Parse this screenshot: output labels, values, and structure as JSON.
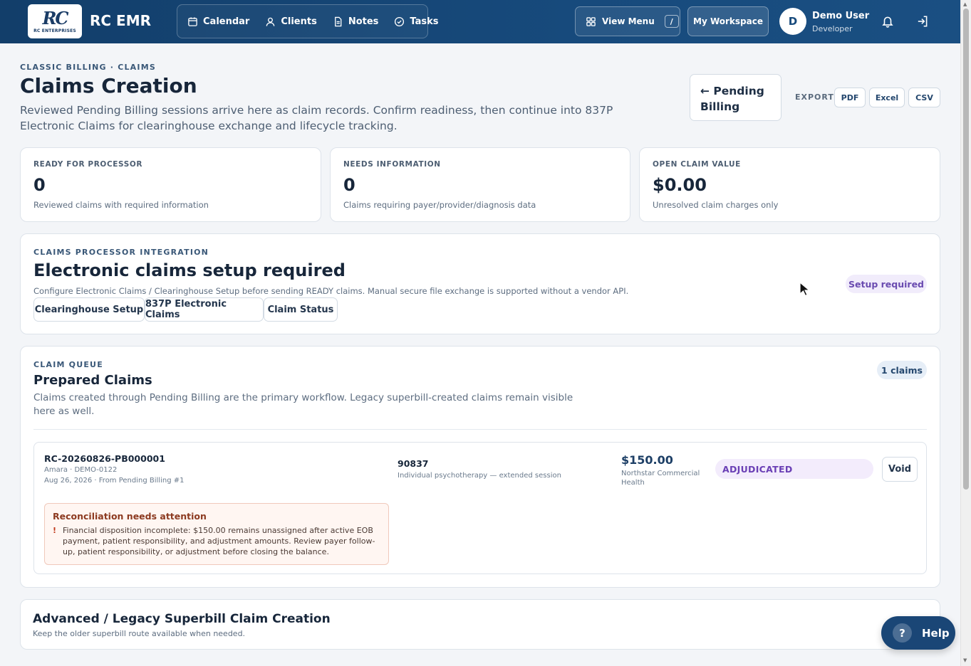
{
  "topbar": {
    "logo_mark": "RC",
    "logo_sub": "RC ENTERPRISES",
    "brand": "RC EMR",
    "nav": [
      {
        "label": "Calendar",
        "icon": "calendar-icon"
      },
      {
        "label": "Clients",
        "icon": "user-icon"
      },
      {
        "label": "Notes",
        "icon": "document-icon"
      },
      {
        "label": "Tasks",
        "icon": "check-circle-icon"
      }
    ],
    "view_menu": "View Menu",
    "view_menu_shortcut": "/",
    "workspace": "My Workspace",
    "avatar_initial": "D",
    "user_name": "Demo User",
    "user_role": "Developer"
  },
  "header": {
    "eyebrow": "CLASSIC BILLING · CLAIMS",
    "title": "Claims Creation",
    "description": "Reviewed Pending Billing sessions arrive here as claim records. Confirm readiness, then continue into 837P Electronic Claims for clearinghouse exchange and lifecycle tracking.",
    "pending_button": "← Pending Billing",
    "export_label": "EXPORT",
    "export_pdf": "PDF",
    "export_excel": "Excel",
    "export_csv": "CSV"
  },
  "stats": [
    {
      "label": "READY FOR PROCESSOR",
      "value": "0",
      "sub": "Reviewed claims with required information"
    },
    {
      "label": "NEEDS INFORMATION",
      "value": "0",
      "sub": "Claims requiring payer/provider/diagnosis data"
    },
    {
      "label": "OPEN CLAIM VALUE",
      "value": "$0.00",
      "sub": "Unresolved claim charges only"
    }
  ],
  "integration": {
    "eyebrow": "CLAIMS PROCESSOR INTEGRATION",
    "title": "Electronic claims setup required",
    "description": "Configure Electronic Claims / Clearinghouse Setup before sending READY claims. Manual secure file exchange is supported without a vendor API.",
    "buttons": [
      "Clearinghouse Setup",
      "837P Electronic Claims",
      "Claim Status"
    ],
    "badge": "Setup required"
  },
  "queue": {
    "eyebrow": "CLAIM QUEUE",
    "title": "Prepared Claims",
    "description": "Claims created through Pending Billing are the primary workflow. Legacy superbill-created claims remain visible here as well.",
    "count": "1 claims",
    "claim": {
      "id": "RC-20260826-PB000001",
      "patient": "Amara · DEMO-0122",
      "date": "Aug 26, 2026 · From Pending Billing #1",
      "cpt": "90837",
      "cpt_desc": "Individual psychotherapy — extended session",
      "amount": "$150.00",
      "payer": "Northstar Commercial Health",
      "status": "ADJUDICATED",
      "void": "Void",
      "alert_title": "Reconciliation needs attention",
      "alert_icon": "!",
      "alert_text": "Financial disposition incomplete: $150.00 remains unassigned after active EOB payment, patient responsibility, and adjustment amounts. Review payer follow-up, patient responsibility, or adjustment before closing the balance."
    }
  },
  "legacy": {
    "title": "Advanced / Legacy Superbill Claim Creation",
    "subtitle": "Keep the older superbill route available when needed."
  },
  "help": {
    "icon": "?",
    "label": "Help"
  },
  "colors": {
    "header_bg": "#174a7c",
    "accent": "#1d3f66",
    "purple_badge": "#6a3fb5",
    "alert_bg": "#fff6f2"
  }
}
